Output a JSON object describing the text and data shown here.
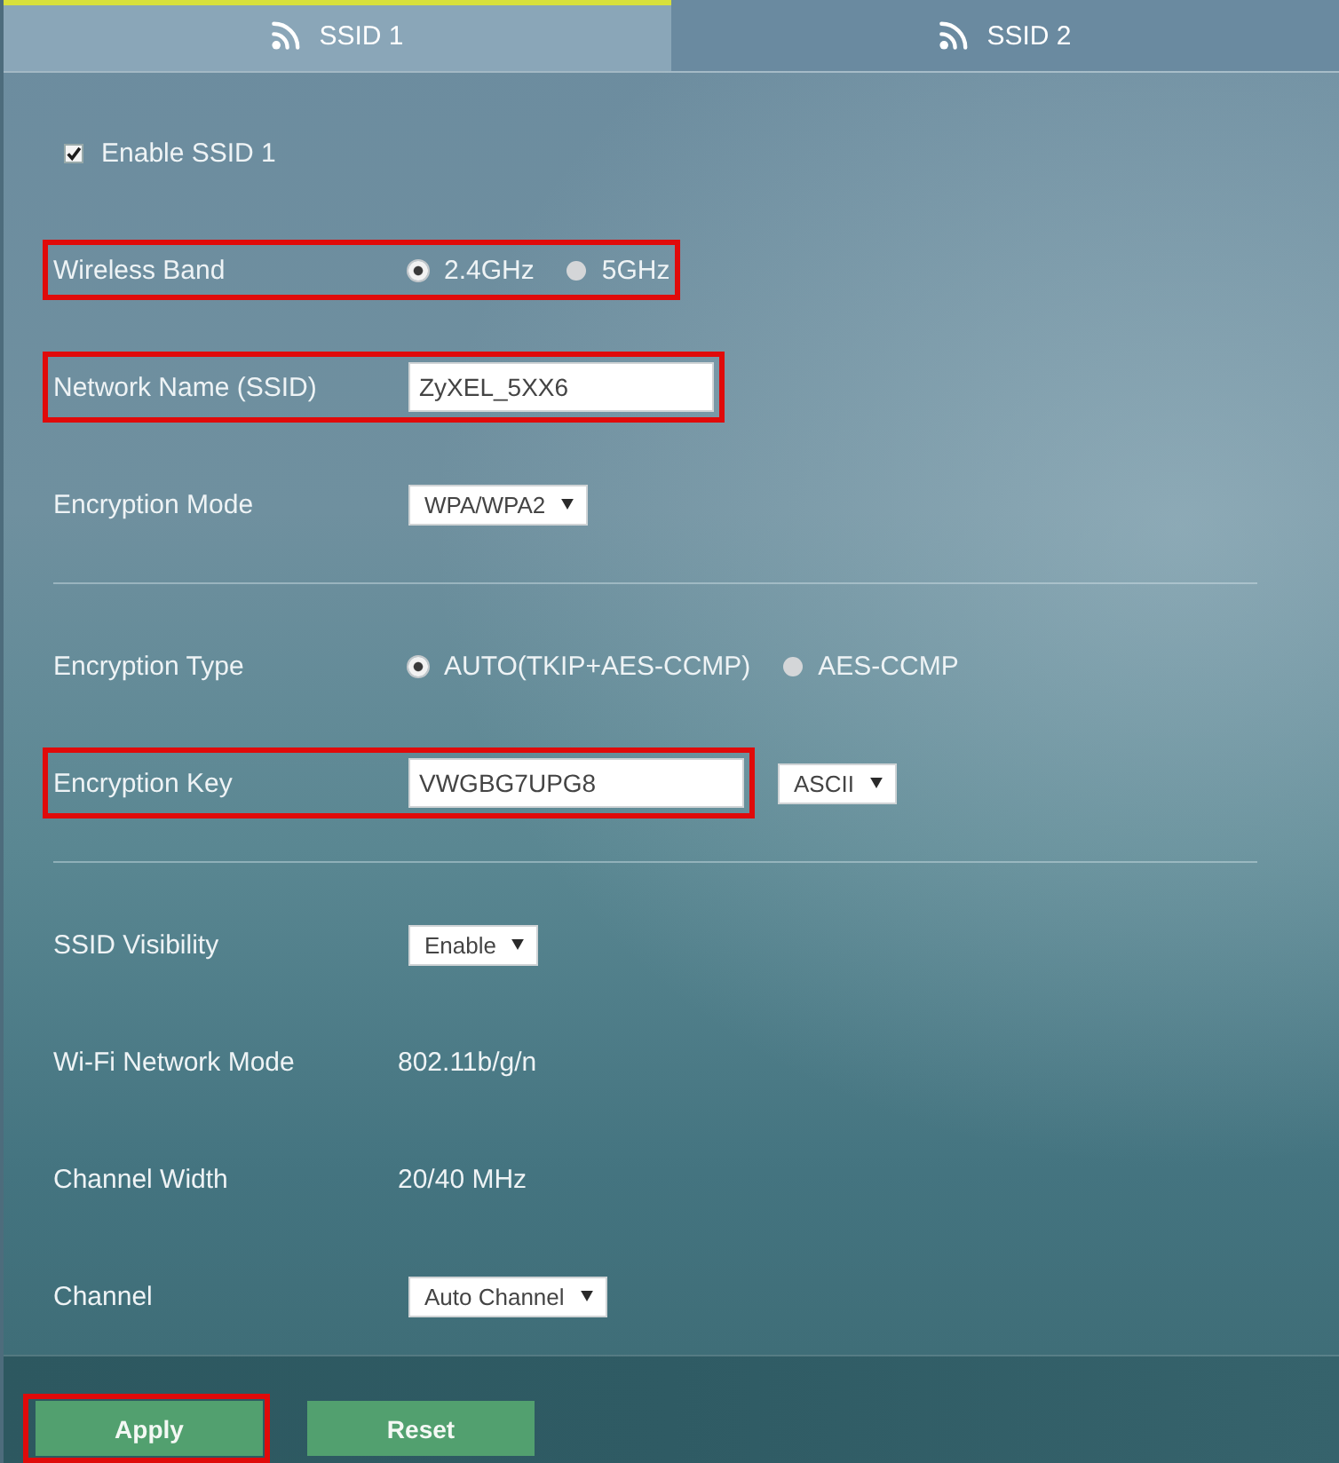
{
  "tabs": [
    {
      "label": "SSID 1",
      "selected": true
    },
    {
      "label": "SSID 2",
      "selected": false
    }
  ],
  "sections": [
    {
      "fields": [
        {
          "kind": "checkbox",
          "label": "Enable SSID 1",
          "checked": true,
          "highlighted": false
        },
        {
          "kind": "radio",
          "label": "Wireless Band",
          "highlighted": true,
          "options": [
            {
              "label": "2.4GHz",
              "selected": true
            },
            {
              "label": "5GHz",
              "selected": false
            }
          ]
        },
        {
          "kind": "input",
          "label": "Network Name (SSID)",
          "highlighted": true,
          "value": "ZyXEL_5XX6"
        },
        {
          "kind": "select",
          "label": "Encryption Mode",
          "highlighted": false,
          "value": "WPA/WPA2"
        }
      ]
    },
    {
      "fields": [
        {
          "kind": "radio",
          "label": "Encryption Type",
          "highlighted": false,
          "options": [
            {
              "label": "AUTO(TKIP+AES-CCMP)",
              "selected": true
            },
            {
              "label": "AES-CCMP",
              "selected": false
            }
          ]
        },
        {
          "kind": "input",
          "label": "Encryption Key",
          "highlighted": true,
          "value": "VWGBG7UPG8",
          "format": "ASCII"
        }
      ]
    },
    {
      "fields": [
        {
          "kind": "select",
          "label": "SSID Visibility",
          "highlighted": false,
          "value": "Enable"
        },
        {
          "kind": "static",
          "label": "Wi-Fi Network Mode",
          "highlighted": false,
          "value": "802.11b/g/n"
        },
        {
          "kind": "static",
          "label": "Channel Width",
          "highlighted": false,
          "value": "20/40 MHz"
        },
        {
          "kind": "select",
          "label": "Channel",
          "highlighted": false,
          "value": "Auto Channel"
        }
      ]
    }
  ],
  "buttons": [
    {
      "label": "Apply",
      "highlighted": true
    },
    {
      "label": "Reset",
      "highlighted": false
    }
  ]
}
